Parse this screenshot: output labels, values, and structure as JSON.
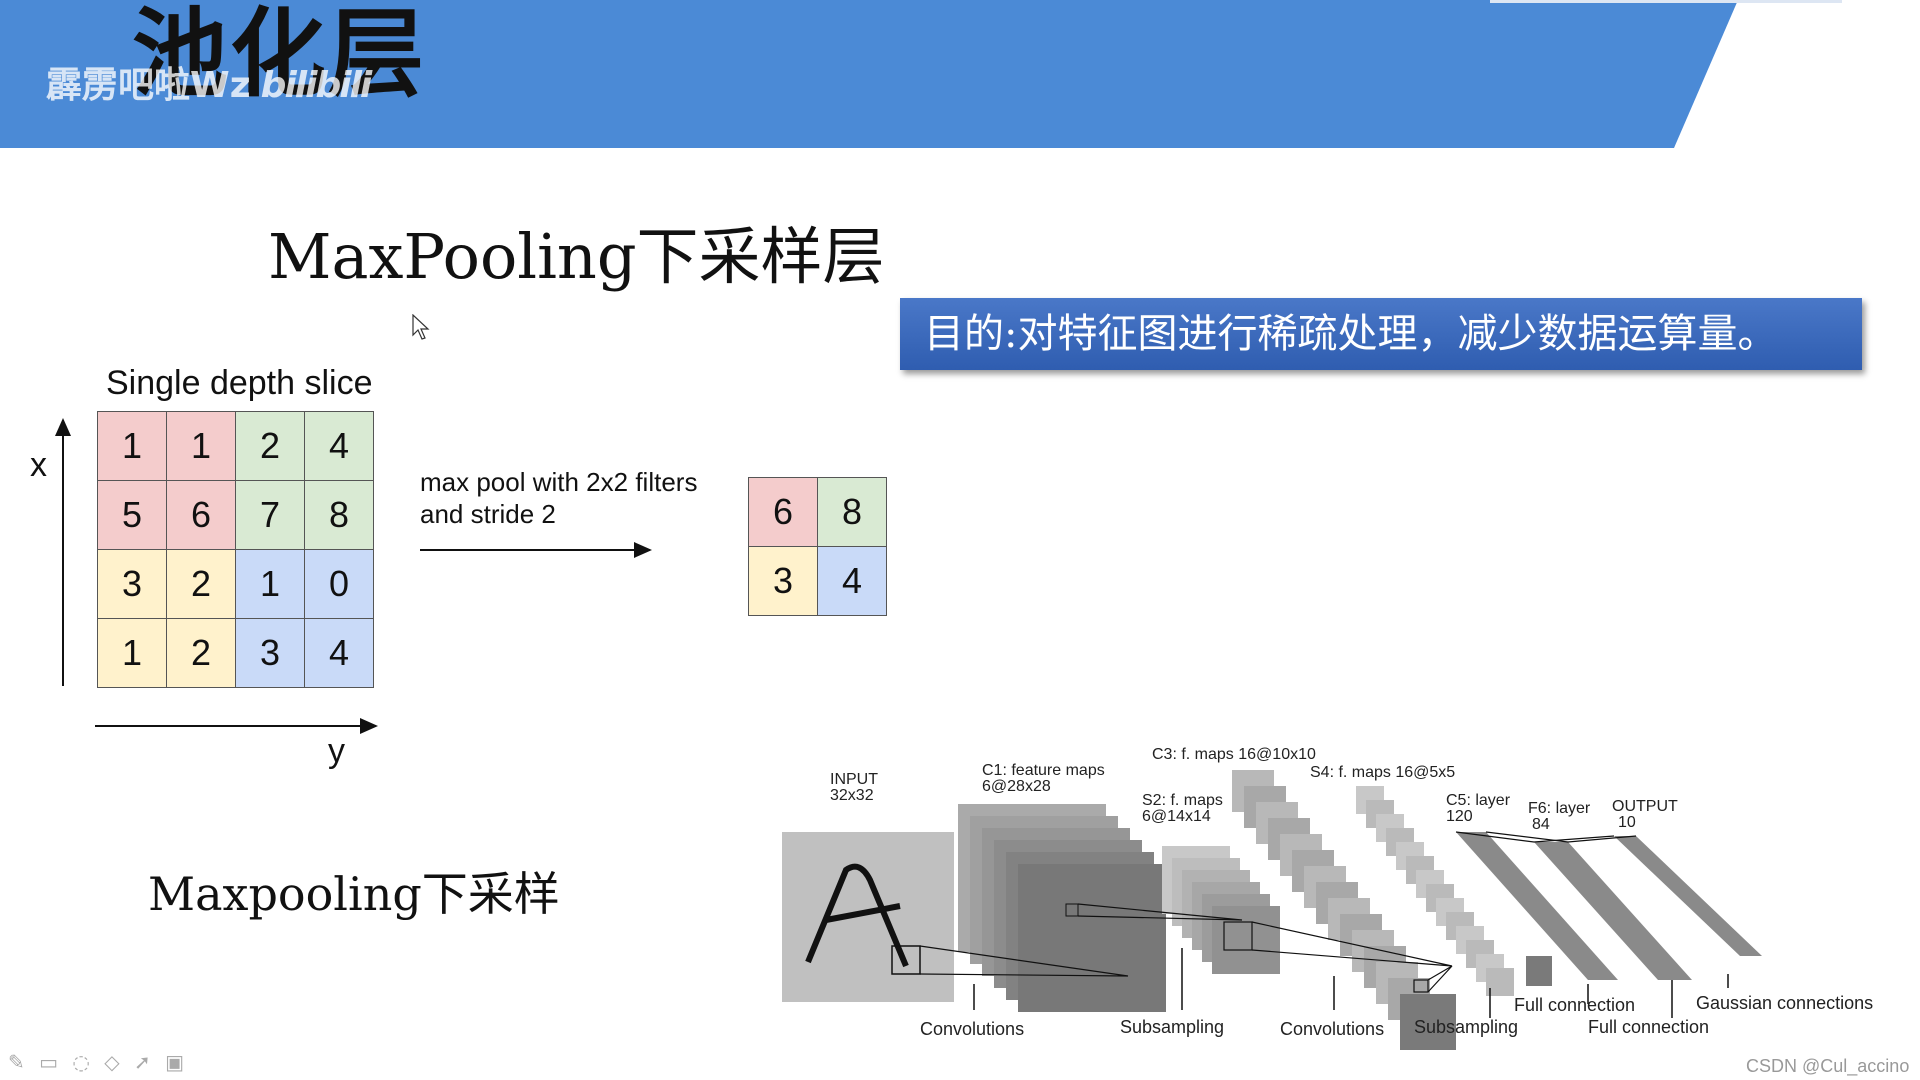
{
  "banner": {
    "title": "池化层",
    "watermark_text": "霹雳吧啦Wz",
    "watermark_logo": "bilibili",
    "color": "#4b8ad6"
  },
  "heading": "MaxPooling下采样层",
  "purpose": "目的:对特征图进行稀疏处理，减少数据运算量。",
  "example": {
    "slice_title": "Single depth slice",
    "x_label": "x",
    "y_label": "y",
    "input_grid": [
      [
        1,
        1,
        2,
        4
      ],
      [
        5,
        6,
        7,
        8
      ],
      [
        3,
        2,
        1,
        0
      ],
      [
        1,
        2,
        3,
        4
      ]
    ],
    "caption_line1": "max pool with 2x2 filters",
    "caption_line2": "and stride 2",
    "output_grid": [
      [
        6,
        8
      ],
      [
        3,
        4
      ]
    ]
  },
  "sub_heading": "Maxpooling下采样",
  "lenet": {
    "input": [
      "INPUT",
      "32x32"
    ],
    "c1": [
      "C1: feature maps",
      "6@28x28"
    ],
    "s2": [
      "S2: f. maps",
      "6@14x14"
    ],
    "c3": "C3: f. maps 16@10x10",
    "s4": "S4: f. maps 16@5x5",
    "c5": [
      "C5: layer",
      "120"
    ],
    "f6": [
      "F6: layer",
      "84"
    ],
    "output": [
      "OUTPUT",
      "10"
    ],
    "bottom_labels": [
      "Convolutions",
      "Subsampling",
      "Convolutions",
      "Subsampling",
      "Full connection",
      "Full connection",
      "Gaussian connections"
    ]
  },
  "credit": "CSDN @Cul_accino",
  "toolbar_icons": [
    "pen-icon",
    "screen-icon",
    "highlighter-icon",
    "eraser-icon",
    "pointer-icon",
    "camera-icon"
  ]
}
